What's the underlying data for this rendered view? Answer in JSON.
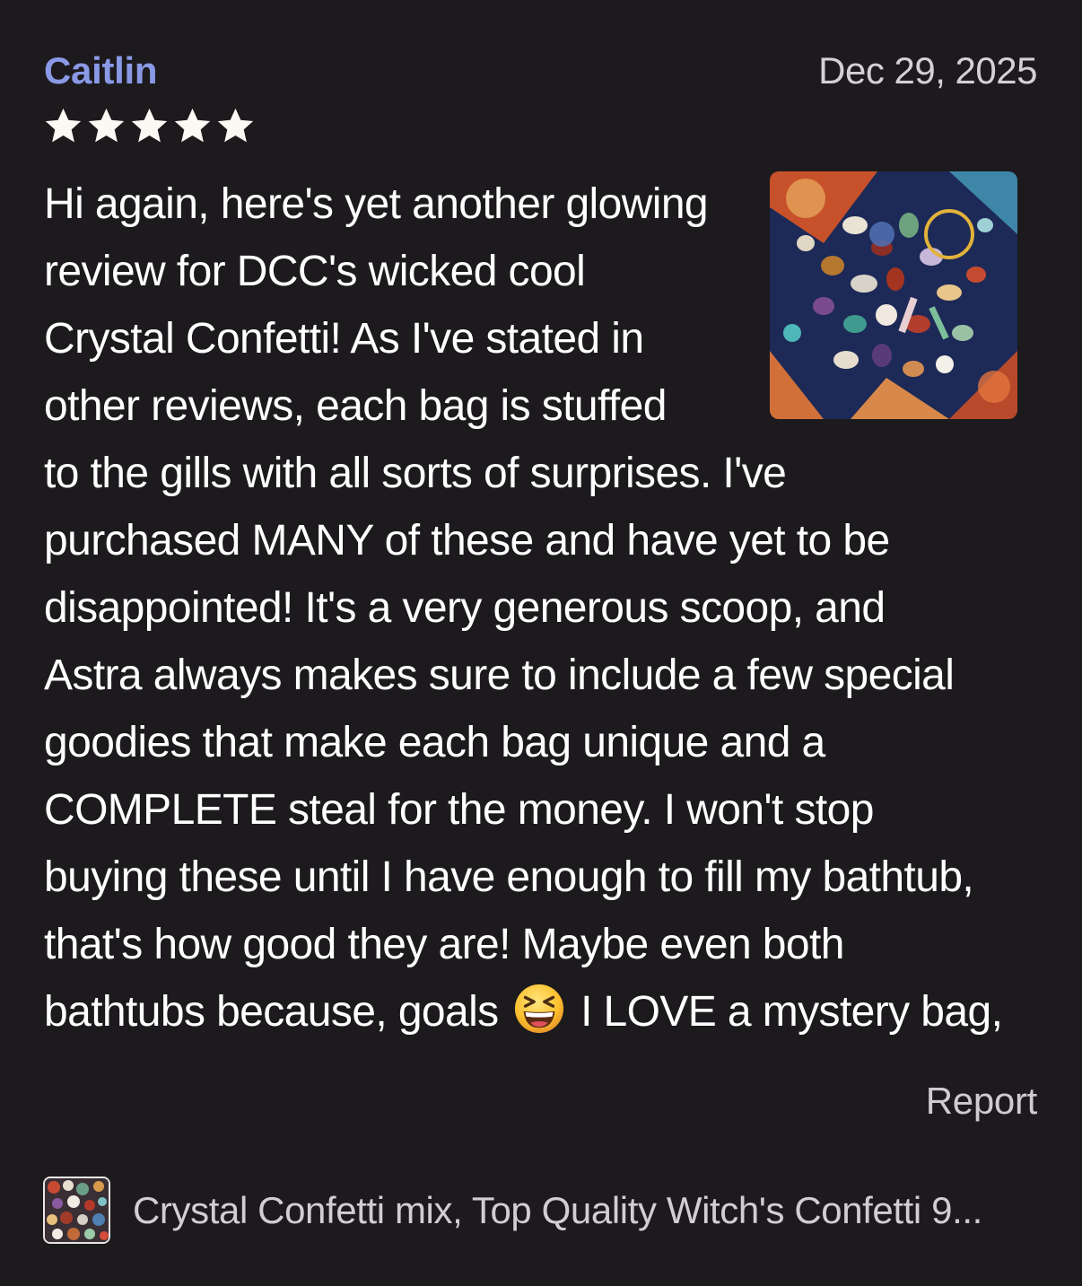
{
  "review": {
    "reviewer_name": "Caitlin",
    "date": "Dec 29, 2025",
    "rating": 5,
    "rating_max": 5,
    "text_lines": [
      "Hi again, here's yet another glowing",
      "review for DCC's wicked cool",
      "Crystal Confetti! As I've stated in",
      "other reviews, each bag is stuffed",
      "to the gills with all sorts of surprises. I've",
      "purchased MANY of these and have yet to be",
      "disappointed! It's a very generous scoop, and",
      "Astra always makes sure to include a few special",
      "goodies that make each bag unique and a",
      "COMPLETE steal for the money. I won't stop",
      "buying these until I have enough to fill my bathtub,",
      "that's how good they are! Maybe even both"
    ],
    "last_line_before_emoji": "bathtubs because, goals",
    "emoji_icon": "grinning-squinting-face-icon",
    "last_line_after_emoji": "I LOVE a mystery bag,",
    "photo_icon": "crystal-collection-photo",
    "report_label": "Report"
  },
  "product": {
    "thumbnail_icon": "crystal-confetti-thumbnail",
    "name": "Crystal Confetti mix, Top Quality Witch's Confetti 9..."
  },
  "colors": {
    "background": "#1c1a1d",
    "reviewer_name": "#8a99e6",
    "star": "#fbf9f3",
    "text": "#ffffff",
    "secondary_text": "#d2cdd4"
  }
}
